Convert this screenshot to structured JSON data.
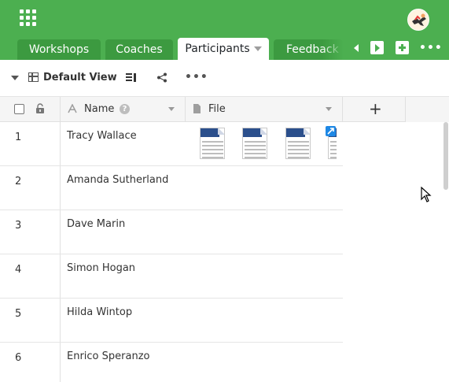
{
  "header": {
    "tabs": [
      {
        "label": "Workshops",
        "active": false
      },
      {
        "label": "Coaches",
        "active": false
      },
      {
        "label": "Participants",
        "active": true
      },
      {
        "label": "Feedback",
        "active": false
      }
    ],
    "colors": {
      "brand": "#4caf50",
      "tab_inactive": "#3c9a40"
    }
  },
  "toolbar": {
    "view_label": "Default View"
  },
  "table": {
    "columns": [
      {
        "label": "Name",
        "type_icon": "text-icon"
      },
      {
        "label": "File",
        "type_icon": "file-icon"
      }
    ],
    "add_column_label": "+",
    "rows": [
      {
        "num": "1",
        "name": "Tracy Wallace",
        "files": 4
      },
      {
        "num": "2",
        "name": "Amanda Sutherland",
        "files": 0
      },
      {
        "num": "3",
        "name": "Dave Marin",
        "files": 0
      },
      {
        "num": "4",
        "name": "Simon Hogan",
        "files": 0
      },
      {
        "num": "5",
        "name": "Hilda Wintop",
        "files": 0
      },
      {
        "num": "6",
        "name": "Enrico Speranzo",
        "files": 0
      }
    ]
  }
}
